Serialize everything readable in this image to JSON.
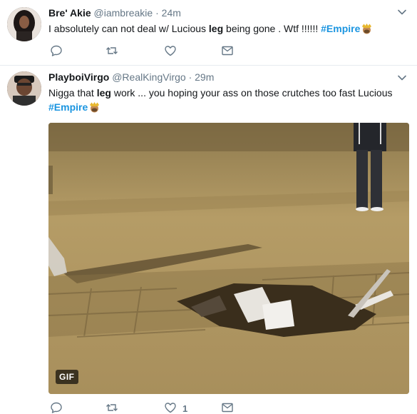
{
  "tweets": [
    {
      "name": "Bre' Akie",
      "handle": "@iambreakie",
      "separator": "·",
      "time": "24m",
      "text_before": "I absolutely can not deal w/ Lucious ",
      "text_bold": "leg",
      "text_after": " being gone . Wtf !!!!!! ",
      "hashtag": "#Empire",
      "actions": {
        "reply": "reply-icon",
        "retweet": "retweet-icon",
        "like": "heart-icon",
        "message": "mail-icon"
      }
    },
    {
      "name": "PlayboiVirgo",
      "handle": "@RealKingVirgo",
      "separator": "·",
      "time": "29m",
      "text_before": "Nigga that ",
      "text_bold": "leg",
      "text_after": " work ... you hoping your ass on those crutches too fast Lucious",
      "hashtag": "#Empire",
      "media_badge": "GIF",
      "like_count": "1",
      "actions": {
        "reply": "reply-icon",
        "retweet": "retweet-icon",
        "like": "heart-icon",
        "message": "mail-icon"
      }
    }
  ],
  "colors": {
    "link": "#1b95e0",
    "secondary": "#657786",
    "text": "#14171a",
    "divider": "#e6ecf0"
  }
}
